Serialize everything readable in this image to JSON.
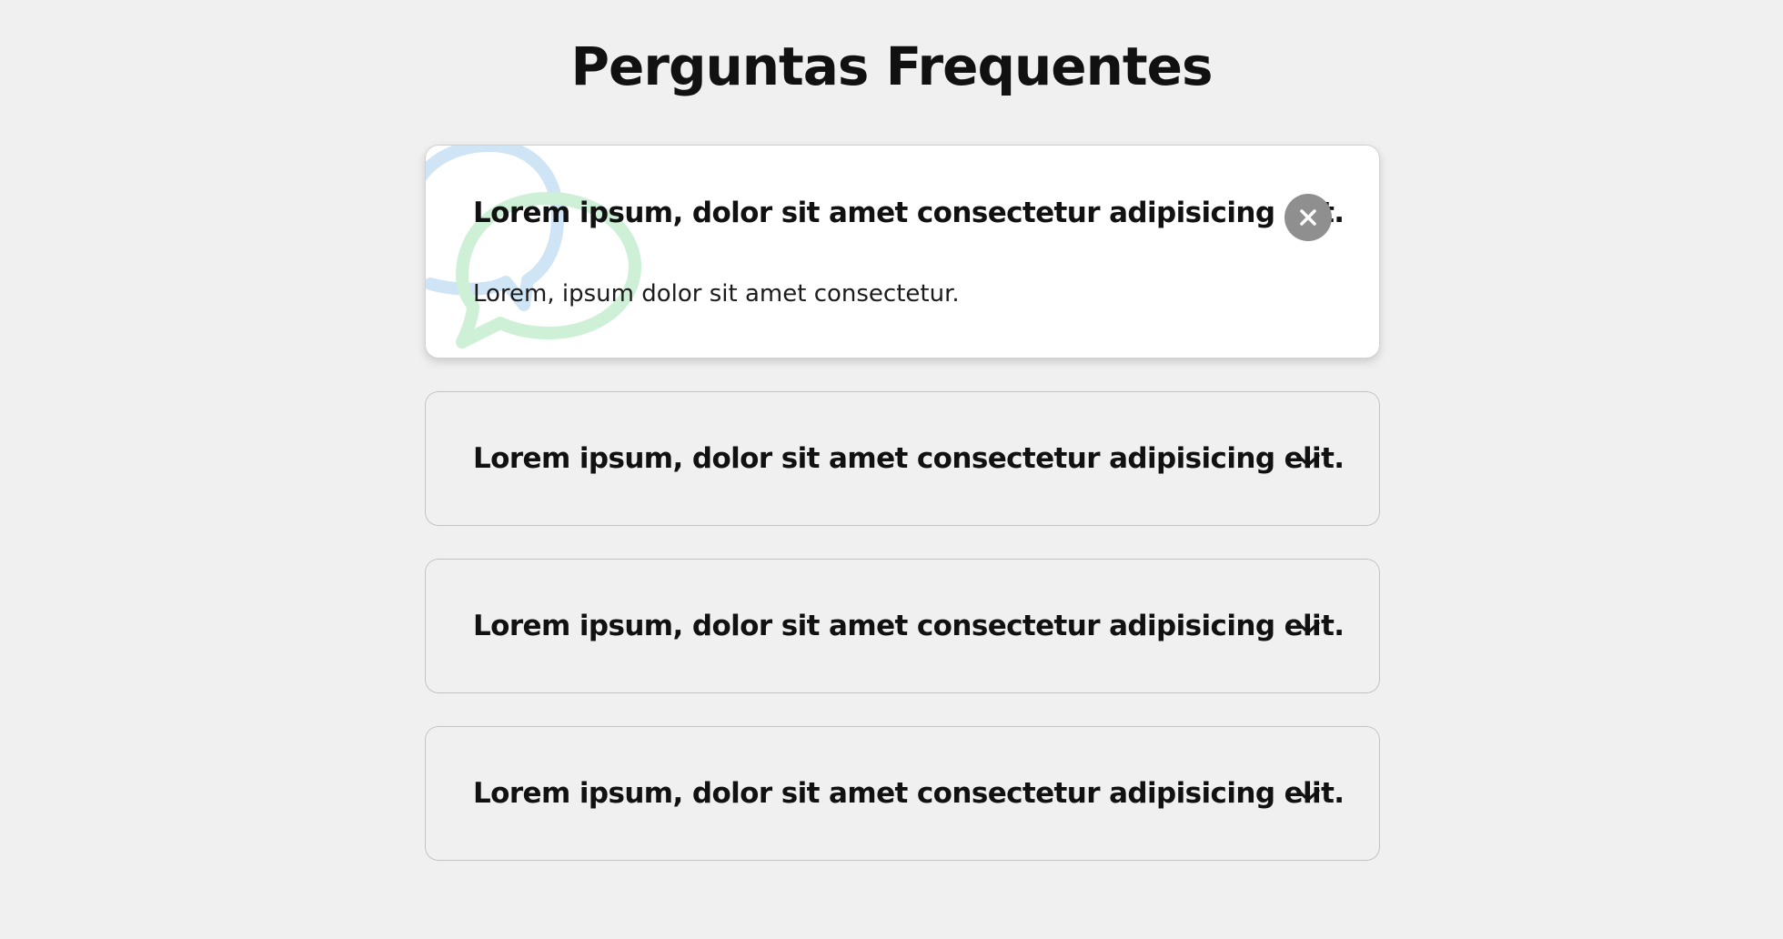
{
  "page": {
    "title": "Perguntas Frequentes"
  },
  "faq": {
    "items": [
      {
        "question": "Lorem ipsum, dolor sit amet consectetur adipisicing elit.",
        "answer": "Lorem, ipsum dolor sit amet consectetur.",
        "expanded": true,
        "toggle_icon": "close-icon"
      },
      {
        "question": "Lorem ipsum, dolor sit amet consectetur adipisicing elit.",
        "expanded": false,
        "toggle_icon": "chevron-down-icon"
      },
      {
        "question": "Lorem ipsum, dolor sit amet consectetur adipisicing elit.",
        "expanded": false,
        "toggle_icon": "chevron-down-icon"
      },
      {
        "question": "Lorem ipsum, dolor sit amet consectetur adipisicing elit.",
        "expanded": false,
        "toggle_icon": "chevron-down-icon"
      }
    ]
  },
  "colors": {
    "page_background": "#f0f0f0",
    "active_card_background": "#ffffff",
    "close_button": "#8f8f8f",
    "bubble_blue": "#cfe4f5",
    "bubble_green": "#cdf0d7"
  }
}
